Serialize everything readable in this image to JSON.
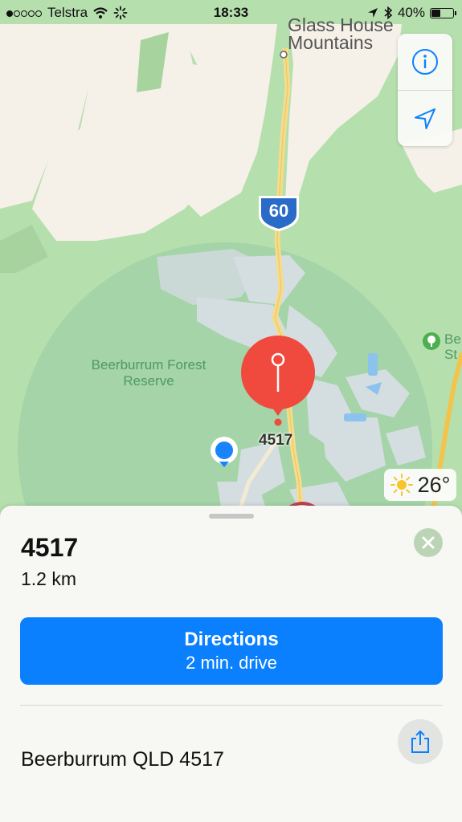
{
  "status_bar": {
    "carrier": "Telstra",
    "time": "18:33",
    "battery": "40%",
    "signal_bars_filled": 1,
    "signal_bars_total": 5
  },
  "map": {
    "place_label": "Glass House Mountains",
    "highway_shield": "60",
    "forest_label": "Beerburrum Forest Reserve",
    "edge_label": "Be St",
    "pin_label": "4517",
    "weather_temp": "26°",
    "icons": [
      "info-icon",
      "location-arrow-icon",
      "sun-icon",
      "tree-icon",
      "user-location-icon",
      "dropped-pin-icon"
    ]
  },
  "sheet": {
    "title": "4517",
    "distance": "1.2 km",
    "directions_label": "Directions",
    "directions_sub": "2 min. drive",
    "address": "Beerburrum QLD 4517"
  },
  "colors": {
    "accent": "#0a80fe",
    "pin": "#f0493e",
    "map_green": "#acd8a4",
    "map_land": "#f5f1e8"
  }
}
